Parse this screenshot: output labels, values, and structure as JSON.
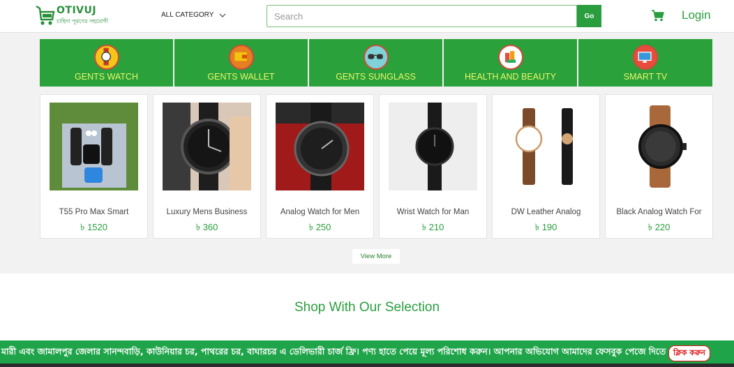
{
  "header": {
    "logo_text": "OTIVUJ",
    "logo_tagline": "চাহিদা পূরণের সহযোগী",
    "all_category": "ALL CATEGORY",
    "search_placeholder": "Search",
    "go_label": "Go",
    "login_label": "Login"
  },
  "categories": [
    {
      "label": "GENTS WATCH",
      "icon": "watch-icon"
    },
    {
      "label": "GENTS WALLET",
      "icon": "wallet-icon"
    },
    {
      "label": "GENTS SUNGLASS",
      "icon": "sunglass-icon"
    },
    {
      "label": "HEALTH AND BEAUTY",
      "icon": "beauty-icon"
    },
    {
      "label": "SMART TV",
      "icon": "tv-icon"
    }
  ],
  "products": [
    {
      "name": "T55 Pro Max Smart",
      "price": "৳ 1520"
    },
    {
      "name": "Luxury Mens Business",
      "price": "৳ 360"
    },
    {
      "name": "Analog Watch for Men",
      "price": "৳ 250"
    },
    {
      "name": "Wrist Watch for Man",
      "price": "৳ 210"
    },
    {
      "name": "DW Leather Analog",
      "price": "৳ 190"
    },
    {
      "name": "Black Analog Watch For",
      "price": "৳ 220"
    }
  ],
  "view_more": "View More",
  "section_title": "Shop With Our Selection",
  "marquee": {
    "text": "মারী এবং জামালপুর জেলার সানন্দবাড়ি, কাউনিয়ার চর, পাথরের চর, বাঘারচর এ ডেলিভারী চার্জ ফ্রি। পণ্য হাতে পেয়ে মূল্য পরিশোধ করুন। আপনার অভিযোগ আমাদের ফেসবুক পেজে দিতে এখানে",
    "link": "ক্লিক করুন"
  },
  "colors": {
    "brand_green": "#2aa13a",
    "category_label": "#e8f86a",
    "marquee_bg": "#20a44a"
  }
}
